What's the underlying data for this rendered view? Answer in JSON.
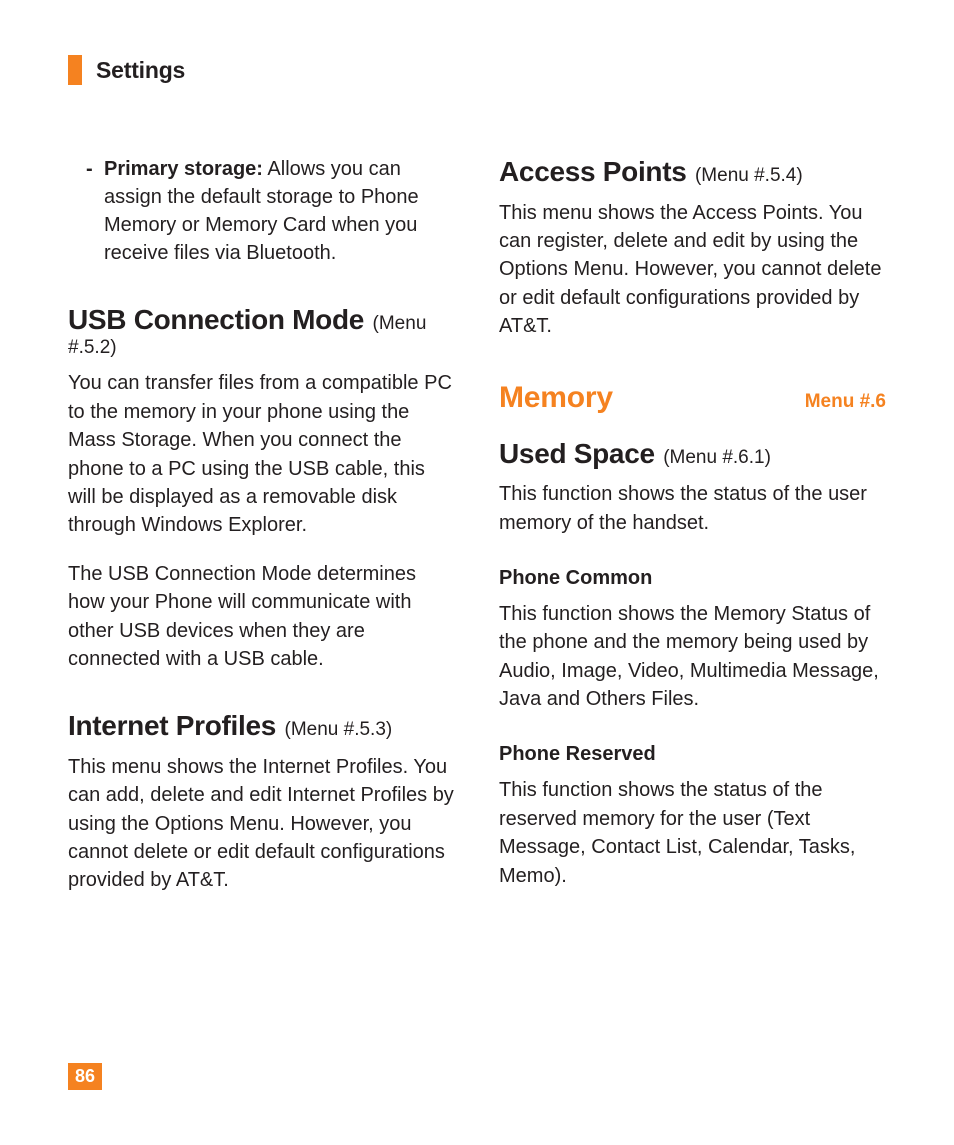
{
  "header": {
    "title": "Settings"
  },
  "page_number": "86",
  "left": {
    "bullet": {
      "label": "Primary storage:",
      "text": " Allows you can assign the default storage to Phone Memory or Memory Card when you receive files via Bluetooth."
    },
    "usb": {
      "title": "USB Connection Mode",
      "menu_ref": "(Menu #.5.2)",
      "p1": "You can transfer files from a compatible PC to the memory in your phone using the Mass Storage. When you connect the phone to a PC using the USB cable, this will be displayed as a removable disk through Windows Explorer.",
      "p2": "The USB Connection Mode determines how your Phone will communicate with other USB devices when they are connected with a USB cable."
    },
    "internet": {
      "title": "Internet Profiles",
      "menu_ref": "(Menu #.5.3)",
      "p1": "This menu shows the Internet Profiles. You can add, delete and edit Internet Profiles by using the Options Menu. However, you cannot delete or edit default configurations provided by AT&T."
    }
  },
  "right": {
    "access": {
      "title": "Access Points",
      "menu_ref": "(Menu #.5.4)",
      "p1": "This menu shows the Access Points. You can register, delete and edit by using the Options Menu. However, you cannot delete or edit default configurations provided by AT&T."
    },
    "memory": {
      "title": "Memory",
      "menu_ref": "Menu #.6"
    },
    "used": {
      "title": "Used Space",
      "menu_ref": "(Menu #.6.1)",
      "p1": "This function shows the status of the user memory of the handset."
    },
    "phone_common": {
      "title": "Phone Common",
      "p1": "This function shows the Memory Status of the phone and the memory being used by Audio, Image, Video, Multimedia Message, Java and Others Files."
    },
    "phone_reserved": {
      "title": "Phone Reserved",
      "p1": "This function shows the status of the reserved memory for the user (Text Message, Contact List, Calendar, Tasks, Memo)."
    }
  }
}
